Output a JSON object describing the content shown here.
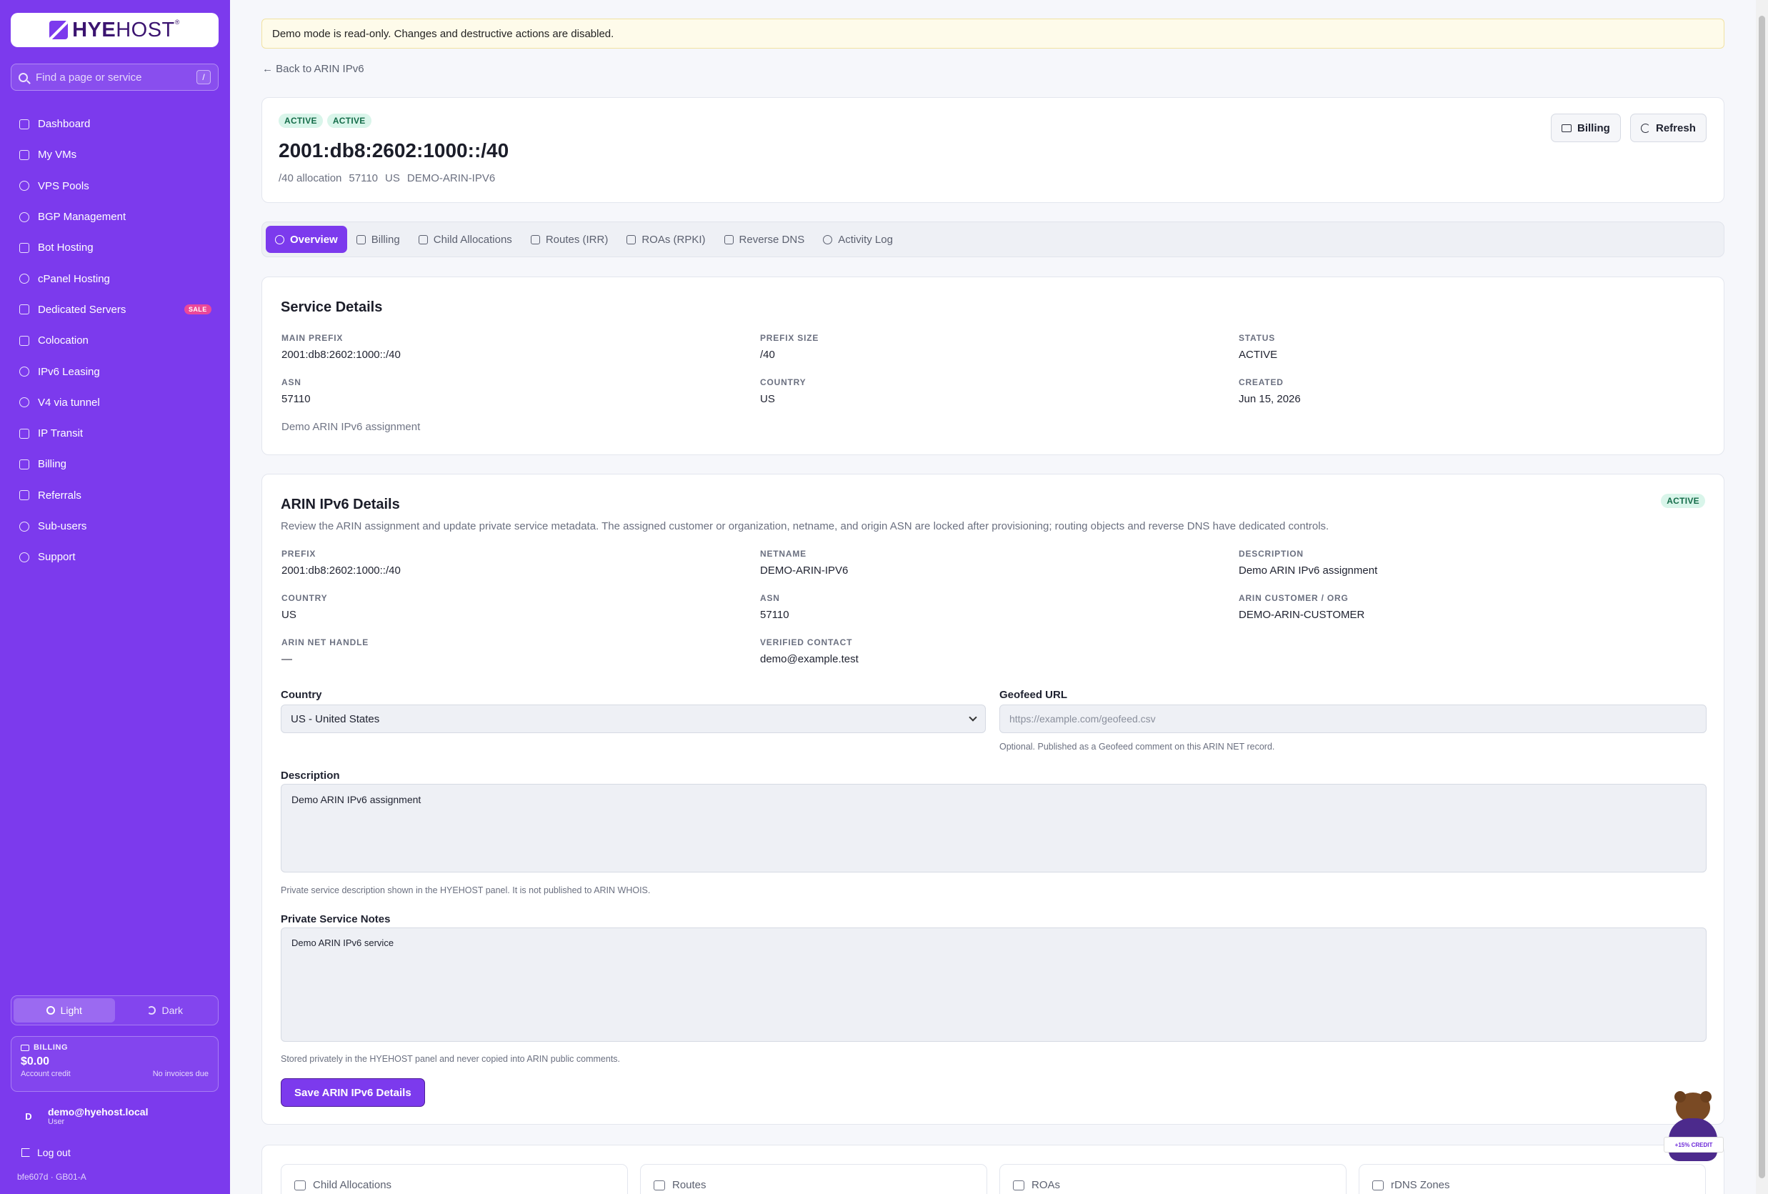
{
  "app": {
    "logo_text_bold": "HYE",
    "logo_text_light": "HOST",
    "logo_mark": "®"
  },
  "search": {
    "placeholder": "Find a page or service",
    "shortcut": "/"
  },
  "sidebar": {
    "items": [
      {
        "label": "Dashboard",
        "icon": "grid-icon"
      },
      {
        "label": "My VMs",
        "icon": "server-icon"
      },
      {
        "label": "VPS Pools",
        "icon": "network-icon"
      },
      {
        "label": "BGP Management",
        "icon": "broadcast-icon"
      },
      {
        "label": "Bot Hosting",
        "icon": "bot-icon"
      },
      {
        "label": "cPanel Hosting",
        "icon": "globe-icon"
      },
      {
        "label": "Dedicated Servers",
        "icon": "server-icon",
        "badge": "SALE"
      },
      {
        "label": "Colocation",
        "icon": "building-icon"
      },
      {
        "label": "IPv6 Leasing",
        "icon": "globe-icon"
      },
      {
        "label": "V4 via tunnel",
        "icon": "network-icon"
      },
      {
        "label": "IP Transit",
        "icon": "route-icon"
      },
      {
        "label": "Billing",
        "icon": "receipt-icon"
      },
      {
        "label": "Referrals",
        "icon": "gift-icon"
      },
      {
        "label": "Sub-users",
        "icon": "users-icon"
      },
      {
        "label": "Support",
        "icon": "headset-icon"
      }
    ],
    "theme": {
      "light": "Light",
      "dark": "Dark",
      "active": "light"
    },
    "billing": {
      "heading": "BILLING",
      "amount": "$0.00",
      "credit_label": "Account credit",
      "invoices": "No invoices due"
    },
    "user": {
      "initial": "D",
      "email": "demo@hyehost.local",
      "role": "User"
    },
    "logout": "Log out",
    "build": "bfe607d · GB01-A"
  },
  "banner": "Demo mode is read-only. Changes and destructive actions are disabled.",
  "back_link": "← Back to ARIN IPv6",
  "header": {
    "badges": [
      "ACTIVE",
      "ACTIVE"
    ],
    "title": "2001:db8:2602:1000::/40",
    "meta": [
      "/40 allocation",
      "57110",
      "US",
      "DEMO-ARIN-IPV6"
    ],
    "billing_button": "Billing",
    "refresh_button": "Refresh"
  },
  "tabs": [
    {
      "label": "Overview",
      "active": true
    },
    {
      "label": "Billing"
    },
    {
      "label": "Child Allocations"
    },
    {
      "label": "Routes (IRR)"
    },
    {
      "label": "ROAs (RPKI)"
    },
    {
      "label": "Reverse DNS"
    },
    {
      "label": "Activity Log"
    }
  ],
  "service_details": {
    "title": "Service Details",
    "main_prefix_label": "MAIN PREFIX",
    "main_prefix": "2001:db8:2602:1000::/40",
    "prefix_size_label": "PREFIX SIZE",
    "prefix_size": "/40",
    "status_label": "STATUS",
    "status": "ACTIVE",
    "asn_label": "ASN",
    "asn": "57110",
    "country_label": "COUNTRY",
    "country": "US",
    "created_label": "CREATED",
    "created": "Jun 15, 2026",
    "note": "Demo ARIN IPv6 assignment"
  },
  "arin": {
    "title": "ARIN IPv6 Details",
    "status": "ACTIVE",
    "description": "Review the ARIN assignment and update private service metadata. The assigned customer or organization, netname, and origin ASN are locked after provisioning; routing objects and reverse DNS have dedicated controls.",
    "prefix_label": "PREFIX",
    "prefix": "2001:db8:2602:1000::/40",
    "netname_label": "NETNAME",
    "netname": "DEMO-ARIN-IPV6",
    "desc_label": "DESCRIPTION",
    "desc": "Demo ARIN IPv6 assignment",
    "country_label": "COUNTRY",
    "country": "US",
    "asn_label": "ASN",
    "asn": "57110",
    "org_label": "ARIN CUSTOMER / ORG",
    "org": "DEMO-ARIN-CUSTOMER",
    "handle_label": "ARIN NET HANDLE",
    "handle": "—",
    "contact_label": "VERIFIED CONTACT",
    "contact": "demo@example.test",
    "form": {
      "country_label": "Country",
      "country_value": "US - United States",
      "geofeed_label": "Geofeed URL",
      "geofeed_placeholder": "https://example.com/geofeed.csv",
      "geofeed_hint": "Optional. Published as a Geofeed comment on this ARIN NET record.",
      "description_label": "Description",
      "description_value": "Demo ARIN IPv6 assignment",
      "description_hint": "Private service description shown in the HYEHOST panel. It is not published to ARIN WHOIS.",
      "notes_label": "Private Service Notes",
      "notes_value": "Demo ARIN IPv6 service",
      "notes_hint": "Stored privately in the HYEHOST panel and never copied into ARIN public comments.",
      "save_button": "Save ARIN IPv6 Details"
    }
  },
  "summary_cards": [
    "Child Allocations",
    "Routes",
    "ROAs",
    "rDNS Zones"
  ],
  "mascot_sign": "+15% CREDIT",
  "colors": {
    "accent": "#7c3aed",
    "badge_bg": "#d9f5ea",
    "badge_text": "#146c49",
    "sale": "#ec4899"
  }
}
